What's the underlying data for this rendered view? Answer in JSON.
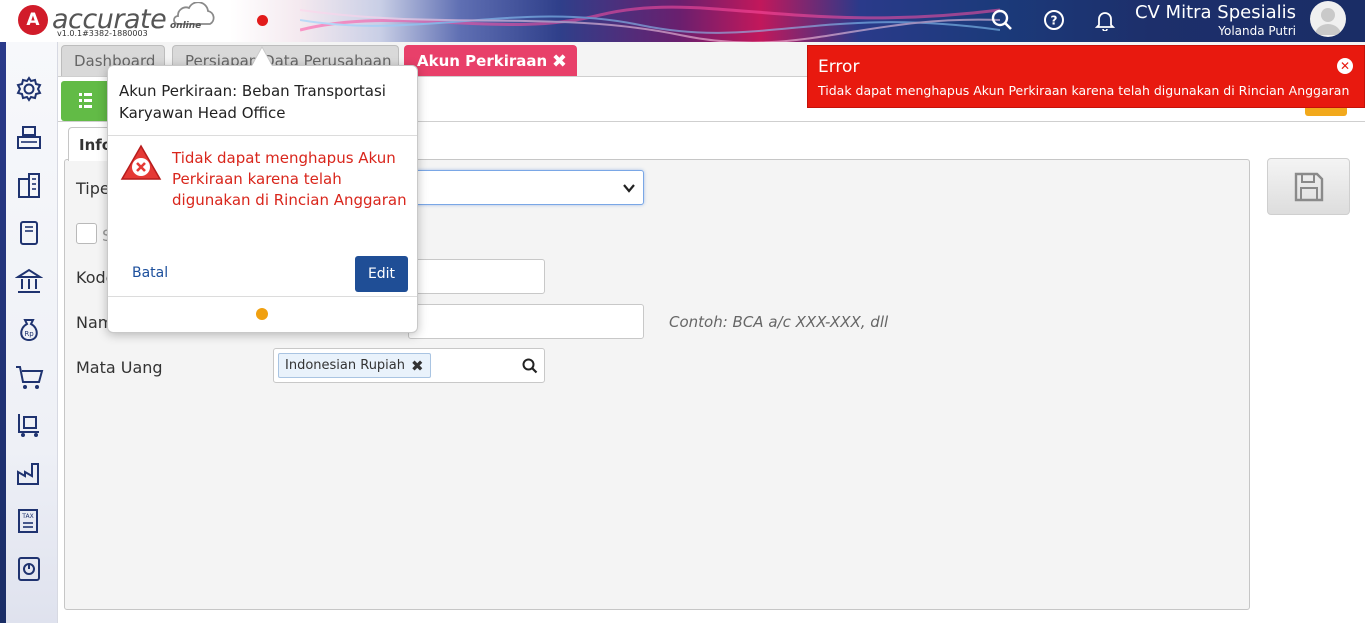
{
  "header": {
    "logo_letter": "A",
    "logo_text": "accurate",
    "logo_sub": "online",
    "version": "v1.0.1#3382-1880003",
    "company_name": "CV Mitra Spesialis",
    "user_name": "Yolanda Putri"
  },
  "tabs": [
    {
      "label": "Dashboard"
    },
    {
      "label": "Persiapan Data Perusahaan"
    },
    {
      "label": "Akun Perkiraan",
      "close": "✖"
    }
  ],
  "form": {
    "inner_tab": "Info",
    "label_tipe": "Tipe",
    "label_sub": "S",
    "label_kode": "Kode",
    "label_nama": "Nama",
    "label_mata_uang": "Mata Uang",
    "nama_hint": "Contoh: BCA a/c XXX-XXX, dll",
    "currency_chip": "Indonesian Rupiah",
    "chip_remove": "✖"
  },
  "popover": {
    "title": "Akun Perkiraan: Beban Transportasi Karyawan Head Office",
    "message": "Tidak dapat menghapus Akun Perkiraan karena telah digunakan di Rincian Anggaran",
    "cancel_label": "Batal",
    "edit_label": "Edit"
  },
  "toast": {
    "title": "Error",
    "message": "Tidak dapat menghapus Akun Perkiraan karena telah digunakan di Rincian Anggaran",
    "close": "✕"
  },
  "colors": {
    "active_tab": "#e8406a",
    "error": "#e8190f",
    "primary_button": "#1f4e96",
    "list_button": "#62bb46",
    "accent_orange": "#f2a91c"
  },
  "icons": {
    "sidebar": [
      "gear-icon",
      "cash-register-icon",
      "building-icon",
      "book-icon",
      "bank-icon",
      "money-bag-icon",
      "shopping-cart-icon",
      "delivery-cart-icon",
      "factory-icon",
      "tax-icon",
      "report-icon"
    ]
  }
}
